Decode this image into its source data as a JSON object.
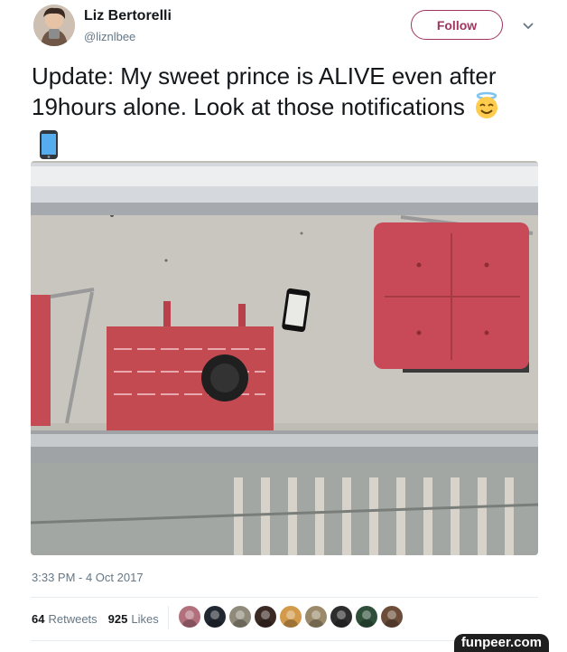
{
  "user": {
    "name": "Liz Bertorelli",
    "handle": "@liznlbee"
  },
  "follow_label": "Follow",
  "tweet": {
    "line1": "Update: My sweet prince is ALIVE even after",
    "line2": "19hours alone. Look at those notifications"
  },
  "timestamp": "3:33 PM - 4 Oct 2017",
  "stats": {
    "retweets_count": "64",
    "retweets_label": "Retweets",
    "likes_count": "925",
    "likes_label": "Likes"
  },
  "liker_avatar_colors": [
    "#b26f7c",
    "#222831",
    "#8f8a7a",
    "#3b2a24",
    "#d29a4a",
    "#9a8a6b",
    "#2d2d2d",
    "#2f4f3a",
    "#6b4d3a"
  ],
  "watermark": "funpeer.com",
  "accent_color": "#a03560",
  "icons": [
    "chevron-down-icon",
    "halo-smiley-emoji",
    "mobile-phone-emoji"
  ]
}
